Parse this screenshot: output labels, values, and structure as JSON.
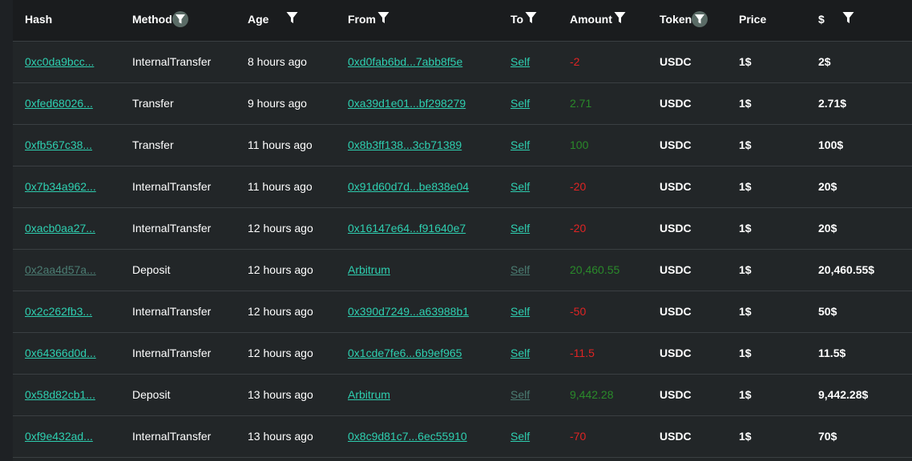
{
  "headers": {
    "hash": "Hash",
    "method": "Method",
    "age": "Age",
    "from": "From",
    "to": "To",
    "amount": "Amount",
    "token": "Token",
    "price": "Price",
    "usd": "$"
  },
  "colors": {
    "link": "#2ecfb0",
    "link_dim": "#4b7c72",
    "negative": "#e02424",
    "positive": "#2a8a2a"
  },
  "rows": [
    {
      "hash": "0xc0da9bcc...",
      "method": "InternalTransfer",
      "age": "8 hours ago",
      "from": "0xd0fab6bd...7abb8f5e",
      "to": "Self",
      "amount": "-2",
      "sign": "neg",
      "token": "USDC",
      "price": "1$",
      "usd": "2$",
      "dim": false
    },
    {
      "hash": "0xfed68026...",
      "method": "Transfer",
      "age": "9 hours ago",
      "from": "0xa39d1e01...bf298279",
      "to": "Self",
      "amount": "2.71",
      "sign": "pos",
      "token": "USDC",
      "price": "1$",
      "usd": "2.71$",
      "dim": false
    },
    {
      "hash": "0xfb567c38...",
      "method": "Transfer",
      "age": "11 hours ago",
      "from": "0x8b3ff138...3cb71389",
      "to": "Self",
      "amount": "100",
      "sign": "pos",
      "token": "USDC",
      "price": "1$",
      "usd": "100$",
      "dim": false
    },
    {
      "hash": "0x7b34a962...",
      "method": "InternalTransfer",
      "age": "11 hours ago",
      "from": "0x91d60d7d...be838e04",
      "to": "Self",
      "amount": "-20",
      "sign": "neg",
      "token": "USDC",
      "price": "1$",
      "usd": "20$",
      "dim": false
    },
    {
      "hash": "0xacb0aa27...",
      "method": "InternalTransfer",
      "age": "12 hours ago",
      "from": "0x16147e64...f91640e7",
      "to": "Self",
      "amount": "-20",
      "sign": "neg",
      "token": "USDC",
      "price": "1$",
      "usd": "20$",
      "dim": false
    },
    {
      "hash": "0x2aa4d57a...",
      "method": "Deposit",
      "age": "12 hours ago",
      "from": "Arbitrum",
      "to": "Self",
      "amount": "20,460.55",
      "sign": "pos",
      "token": "USDC",
      "price": "1$",
      "usd": "20,460.55$",
      "dim": true
    },
    {
      "hash": "0x2c262fb3...",
      "method": "InternalTransfer",
      "age": "12 hours ago",
      "from": "0x390d7249...a63988b1",
      "to": "Self",
      "amount": "-50",
      "sign": "neg",
      "token": "USDC",
      "price": "1$",
      "usd": "50$",
      "dim": false
    },
    {
      "hash": "0x64366d0d...",
      "method": "InternalTransfer",
      "age": "12 hours ago",
      "from": "0x1cde7fe6...6b9ef965",
      "to": "Self",
      "amount": "-11.5",
      "sign": "neg",
      "token": "USDC",
      "price": "1$",
      "usd": "11.5$",
      "dim": false
    },
    {
      "hash": "0x58d82cb1...",
      "method": "Deposit",
      "age": "13 hours ago",
      "from": "Arbitrum",
      "to": "Self",
      "amount": "9,442.28",
      "sign": "pos",
      "token": "USDC",
      "price": "1$",
      "usd": "9,442.28$",
      "dim": "to-only"
    },
    {
      "hash": "0xf9e432ad...",
      "method": "InternalTransfer",
      "age": "13 hours ago",
      "from": "0x8c9d81c7...6ec55910",
      "to": "Self",
      "amount": "-70",
      "sign": "neg",
      "token": "USDC",
      "price": "1$",
      "usd": "70$",
      "dim": false
    }
  ]
}
